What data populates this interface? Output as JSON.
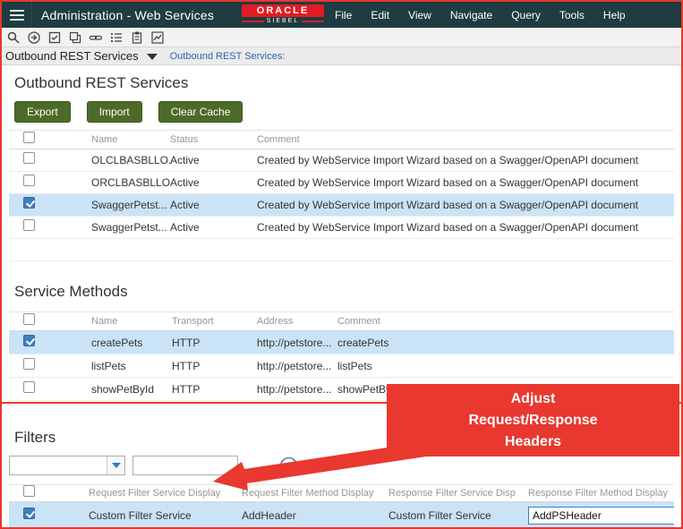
{
  "titlebar": {
    "title": "Administration - Web Services",
    "logo": {
      "primary": "ORACLE",
      "secondary": "SIEBEL"
    },
    "menus": [
      "File",
      "Edit",
      "View",
      "Navigate",
      "Query",
      "Tools",
      "Help"
    ]
  },
  "toolbar": {
    "icons": [
      "search",
      "execute-query",
      "tasks",
      "copy",
      "link",
      "list",
      "clipboard",
      "chart"
    ]
  },
  "breadcrumb": {
    "screen": "Outbound REST Services",
    "view_link": "Outbound REST Services:"
  },
  "outbound": {
    "title": "Outbound REST Services",
    "buttons": {
      "export": "Export",
      "import": "Import",
      "clear_cache": "Clear Cache"
    },
    "columns": [
      "Name",
      "Status",
      "Comment"
    ],
    "rows": [
      {
        "checked": false,
        "selected": false,
        "name": "OLCLBASBLLO...",
        "status": "Active",
        "comment": "Created by WebService Import Wizard based on a Swagger/OpenAPI document"
      },
      {
        "checked": false,
        "selected": false,
        "name": "ORCLBASBLLO...",
        "status": "Active",
        "comment": "Created by WebService Import Wizard based on a Swagger/OpenAPI document"
      },
      {
        "checked": true,
        "selected": true,
        "name": "SwaggerPetst...",
        "status": "Active",
        "comment": "Created by WebService Import Wizard based on a Swagger/OpenAPI document"
      },
      {
        "checked": false,
        "selected": false,
        "name": "SwaggerPetst...",
        "status": "Active",
        "comment": "Created by WebService Import Wizard based on a Swagger/OpenAPI document"
      }
    ]
  },
  "methods": {
    "title": "Service Methods",
    "columns": [
      "Name",
      "Transport",
      "Address",
      "Comment"
    ],
    "rows": [
      {
        "checked": true,
        "selected": true,
        "name": "createPets",
        "transport": "HTTP",
        "address": "http://petstore...",
        "comment": "createPets"
      },
      {
        "checked": false,
        "selected": false,
        "name": "listPets",
        "transport": "HTTP",
        "address": "http://petstore...",
        "comment": "listPets"
      },
      {
        "checked": false,
        "selected": false,
        "name": "showPetById",
        "transport": "HTTP",
        "address": "http://petstore...",
        "comment": "showPetById"
      }
    ]
  },
  "filters": {
    "title": "Filters",
    "dropdown_value": "",
    "query_value": "",
    "columns": [
      "Request Filter Service Display",
      "Request Filter Method Display",
      "Response Filter Service Disp",
      "Response Filter Method Display"
    ],
    "row": {
      "checked": true,
      "selected": true,
      "request_filter_service": "Custom Filter Service",
      "request_filter_method": "AddHeader",
      "response_filter_service": "Custom Filter Service",
      "response_filter_method": "AddPSHeader"
    }
  },
  "callout": {
    "lines": [
      "Adjust",
      "Request/Response",
      "Headers"
    ]
  },
  "colors": {
    "titlebar_bg": "#1e3c42",
    "button_green": "#4c6b28",
    "selected_row_blue": "#cbe3f6",
    "annotation_red": "#e8382f",
    "link_blue": "#2e64b0",
    "logo_red": "#e21b22"
  }
}
